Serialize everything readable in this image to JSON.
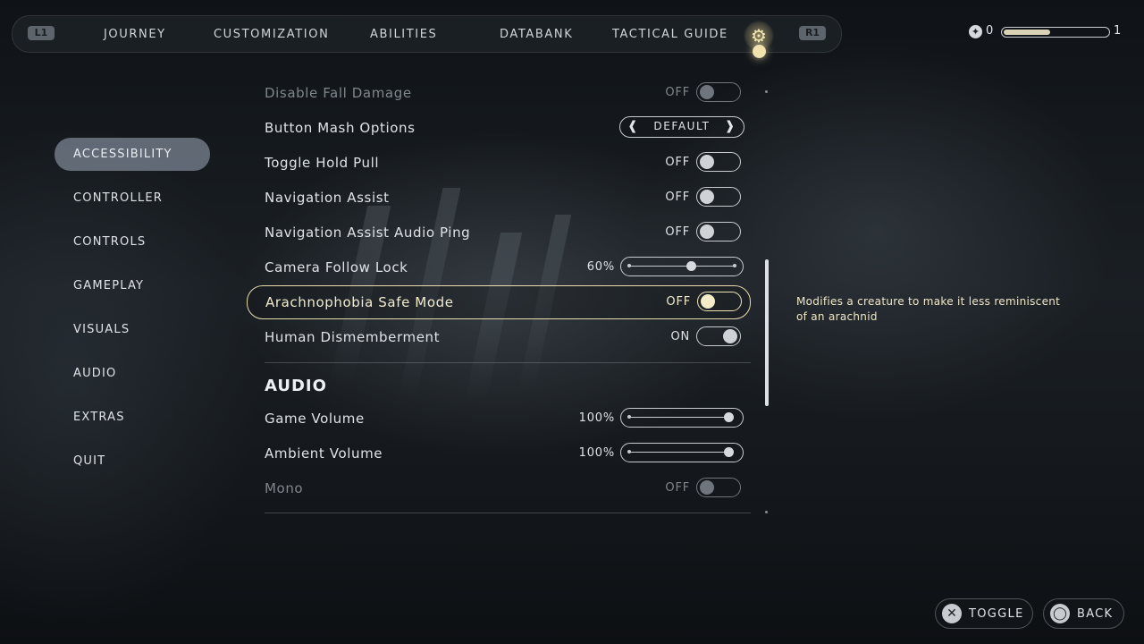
{
  "topbar": {
    "l1": "L1",
    "r1": "R1",
    "tabs": [
      "JOURNEY",
      "CUSTOMIZATION",
      "ABILITIES",
      "DATABANK",
      "TACTICAL GUIDE"
    ],
    "settings_icon": "gear-icon"
  },
  "xp": {
    "current": "0",
    "max": "1",
    "progress": 0.45
  },
  "menu": {
    "items": [
      "ACCESSIBILITY",
      "CONTROLLER",
      "CONTROLS",
      "GAMEPLAY",
      "VISUALS",
      "AUDIO",
      "EXTRAS",
      "QUIT"
    ],
    "active": "ACCESSIBILITY"
  },
  "settings": {
    "disable_fall_damage": {
      "label": "Disable Fall Damage",
      "value": "OFF"
    },
    "button_mash": {
      "label": "Button Mash Options",
      "value": "DEFAULT"
    },
    "toggle_hold_pull": {
      "label": "Toggle Hold Pull",
      "value": "OFF"
    },
    "navigation_assist": {
      "label": "Navigation Assist",
      "value": "OFF"
    },
    "navigation_ping": {
      "label": "Navigation Assist Audio Ping",
      "value": "OFF"
    },
    "camera_follow": {
      "label": "Camera Follow Lock",
      "value": "60%",
      "level": 0.6
    },
    "arachnophobia": {
      "label": "Arachnophobia Safe Mode",
      "value": "OFF"
    },
    "dismemberment": {
      "label": "Human Dismemberment",
      "value": "ON"
    }
  },
  "audio": {
    "title": "AUDIO",
    "game_volume": {
      "label": "Game Volume",
      "value": "100%",
      "level": 1.0
    },
    "ambient_volume": {
      "label": "Ambient Volume",
      "value": "100%",
      "level": 1.0
    },
    "mono": {
      "label": "Mono",
      "value": "OFF"
    }
  },
  "description": "Modifies a creature to make it less reminiscent of an arachnid",
  "footer": {
    "toggle": "TOGGLE",
    "back": "BACK"
  },
  "colors": {
    "accent": "#f2e3ae",
    "active_menu": "#8e9aac"
  }
}
